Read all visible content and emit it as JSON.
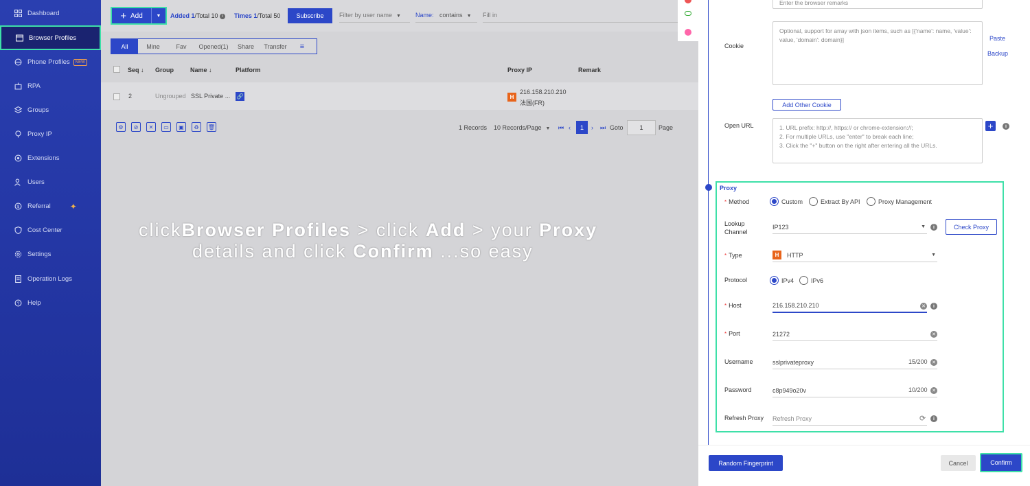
{
  "sidebar": {
    "items": [
      {
        "label": "Dashboard",
        "icon": "grid-icon"
      },
      {
        "label": "Browser Profiles",
        "icon": "browser-icon"
      },
      {
        "label": "Phone Profiles",
        "icon": "phone-icon",
        "badge": "NEW"
      },
      {
        "label": "RPA",
        "icon": "robot-icon"
      },
      {
        "label": "Groups",
        "icon": "layers-icon"
      },
      {
        "label": "Proxy IP",
        "icon": "location-icon"
      },
      {
        "label": "Extensions",
        "icon": "puzzle-icon"
      },
      {
        "label": "Users",
        "icon": "users-icon"
      },
      {
        "label": "Referral",
        "icon": "referral-icon"
      },
      {
        "label": "Cost Center",
        "icon": "shield-icon"
      },
      {
        "label": "Settings",
        "icon": "gear-icon"
      },
      {
        "label": "Operation Logs",
        "icon": "log-icon"
      },
      {
        "label": "Help",
        "icon": "help-icon"
      }
    ]
  },
  "toolbar": {
    "add_label": "Add",
    "added_label": "Added",
    "added_value": "1",
    "added_total": "/Total 10",
    "times_label": "Times",
    "times_value": "1",
    "times_total": "/Total 50",
    "subscribe_label": "Subscribe",
    "filter_placeholder": "Filter by user name",
    "name_label": "Name:",
    "contains_label": "contains",
    "fill_placeholder": "Fill in"
  },
  "tabs": [
    {
      "label": "All",
      "active": true
    },
    {
      "label": "Mine"
    },
    {
      "label": "Fav"
    },
    {
      "label": "Opened(1)"
    },
    {
      "label": "Share"
    },
    {
      "label": "Transfer"
    }
  ],
  "table": {
    "headers": {
      "seq": "Seq ↓",
      "group": "Group",
      "name": "Name ↓",
      "platform": "Platform",
      "proxy_ip": "Proxy IP",
      "remark": "Remark"
    },
    "rows": [
      {
        "seq": "2",
        "group": "Ungrouped",
        "name": "SSL Private ...",
        "proxy_type": "H",
        "proxy_ip": "216.158.210.210",
        "proxy_loc": "法国(FR)"
      }
    ]
  },
  "pagination": {
    "records": "1 Records",
    "per_page": "10 Records/Page",
    "current": "1",
    "goto_label": "Goto",
    "goto_value": "1",
    "page_label": "Page"
  },
  "overlay": {
    "line1_a": "click",
    "line1_b": "Browser Profiles",
    "line1_c": " > click ",
    "line1_d": "Add",
    "line1_e": " > your ",
    "line1_f": "Proxy",
    "line2_a": "details and click ",
    "line2_b": "Confirm",
    "line2_c": " ...so easy"
  },
  "drawer": {
    "remark_placeholder": "Enter the browser remarks",
    "cookie_label": "Cookie",
    "cookie_placeholder": "Optional, support for array with json items, such as [{'name': name, 'value': value, 'domain': domain}]",
    "paste_label": "Paste",
    "backup_label": "Backup",
    "add_cookie_label": "Add Other Cookie",
    "open_url_label": "Open URL",
    "open_url_placeholder_1": "1. URL prefix: http://, https:// or chrome-extension://;",
    "open_url_placeholder_2": "2. For multiple URLs, use \"enter\" to break each line;",
    "open_url_placeholder_3": "3. Click the \"+\" button on the right after entering all the URLs.",
    "proxy_title": "Proxy",
    "method_label": "Method",
    "method_options": [
      "Custom",
      "Extract By API",
      "Proxy Management"
    ],
    "lookup_label_1": "Lookup",
    "lookup_label_2": "Channel",
    "lookup_value": "IP123",
    "check_proxy_label": "Check Proxy",
    "type_label": "Type",
    "type_badge": "H",
    "type_value": "HTTP",
    "protocol_label": "Protocol",
    "protocol_options": [
      "IPv4",
      "IPv6"
    ],
    "host_label": "Host",
    "host_value": "216.158.210.210",
    "port_label": "Port",
    "port_value": "21272",
    "username_label": "Username",
    "username_value": "sslprivateproxy",
    "username_count": "15/200",
    "password_label": "Password",
    "password_value": "c8p949o20v",
    "password_count": "10/200",
    "refresh_label": "Refresh Proxy",
    "refresh_placeholder": "Refresh Proxy",
    "random_label": "Random Fingerprint",
    "cancel_label": "Cancel",
    "confirm_label": "Confirm"
  },
  "colors": {
    "primary": "#2c47c8",
    "highlight": "#3ee0a8",
    "sidebar": "#2437a5"
  }
}
